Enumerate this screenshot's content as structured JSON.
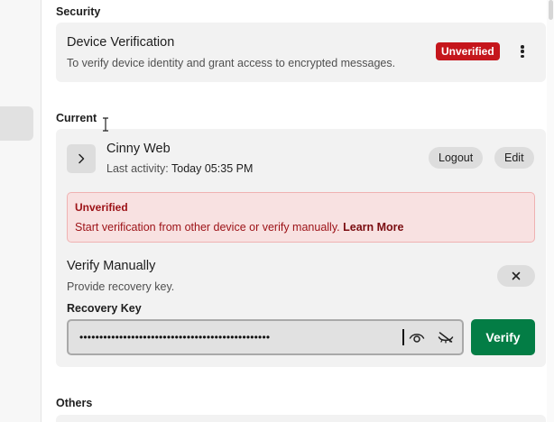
{
  "security": {
    "section_label": "Security",
    "device_verification": {
      "title": "Device Verification",
      "description": "To verify device identity and grant access to encrypted messages.",
      "badge": "Unverified",
      "menu_icon": "more-vertical-icon"
    }
  },
  "current": {
    "section_label": "Current",
    "session": {
      "name": "Cinny Web",
      "last_activity_label": "Last activity:",
      "last_activity_value": "Today 05:35 PM",
      "logout_label": "Logout",
      "edit_label": "Edit",
      "expand_icon": "chevron-right-icon"
    },
    "alert": {
      "title": "Unverified",
      "text": "Start verification from other device or verify manually.",
      "link": "Learn More"
    },
    "verify_manually": {
      "title": "Verify Manually",
      "subtitle": "Provide recovery key.",
      "close_icon": "close-icon",
      "recovery_key_label": "Recovery Key",
      "recovery_key_value": "••••••••••••••••••••••••••••••••••••••••••••••••",
      "show_icon": "eye-icon",
      "hide_icon": "eye-off-icon",
      "verify_label": "Verify"
    }
  },
  "others": {
    "section_label": "Others"
  },
  "colors": {
    "badge_red": "#c5161c",
    "verify_green": "#037d45",
    "alert_bg": "#f8e1e1",
    "alert_text": "#9c1116",
    "card_bg": "#f2f2f2"
  }
}
